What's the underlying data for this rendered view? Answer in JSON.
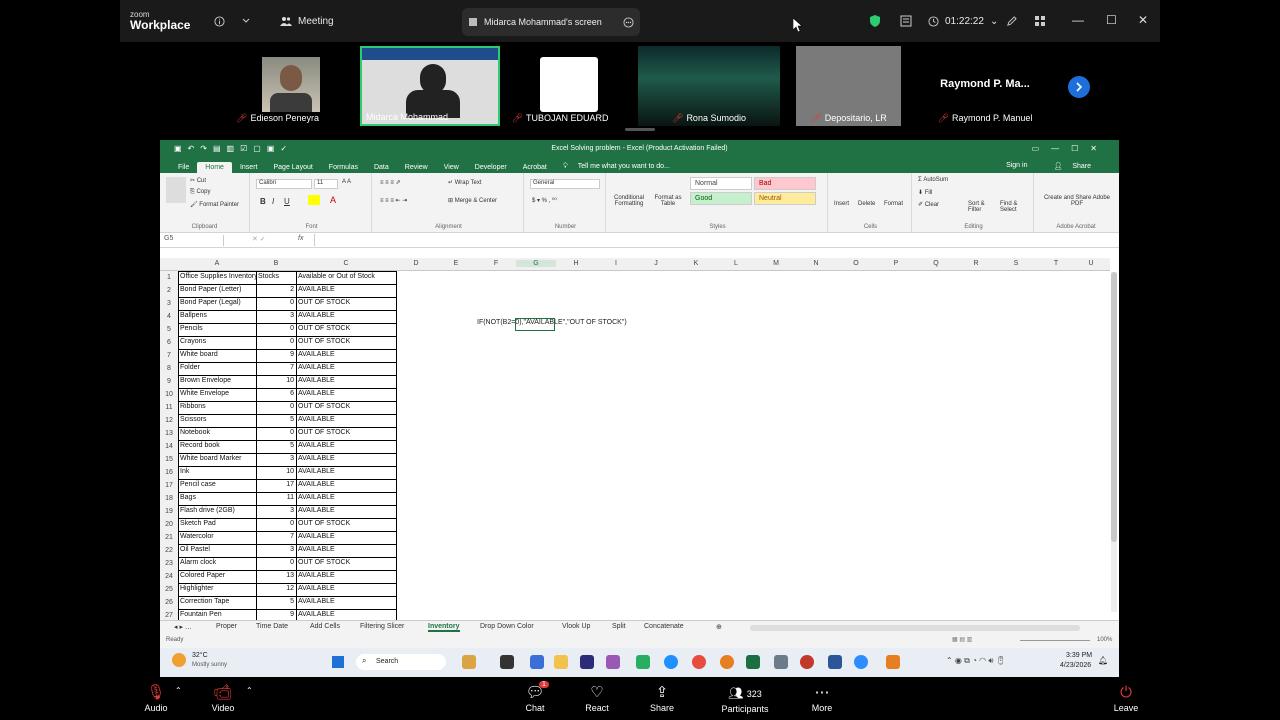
{
  "zoom": {
    "brand_line1": "zoom",
    "brand_line2": "Workplace",
    "meeting_label": "Meeting",
    "screen_label": "Midarca Mohammad's screen",
    "timer": "01:22:22",
    "participants": [
      {
        "name": "Edieson Peneyra"
      },
      {
        "name": "Midarca Mohammad"
      },
      {
        "name": "TUBOJAN EDUARD"
      },
      {
        "name": "Rona Sumodio"
      },
      {
        "name": "Depositario, LR"
      },
      {
        "name": "Raymond P. Manuel",
        "display": "Raymond P. Ma..."
      }
    ],
    "bottom": {
      "audio": "Audio",
      "video": "Video",
      "chat": "Chat",
      "chat_badge": "1",
      "react": "React",
      "share": "Share",
      "participants": "Participants",
      "participants_count": "323",
      "more": "More",
      "leave": "Leave"
    }
  },
  "excel": {
    "title": "Excel Solving problem - Excel (Product Activation Failed)",
    "tabs": [
      "File",
      "Home",
      "Insert",
      "Page Layout",
      "Formulas",
      "Data",
      "Review",
      "View",
      "Developer",
      "Acrobat"
    ],
    "tell_me": "Tell me what you want to do...",
    "sign_in": "Sign in",
    "share": "Share",
    "ribbon": {
      "cut": "Cut",
      "copy": "Copy",
      "format_painter": "Format Painter",
      "clipboard": "Clipboard",
      "font_name": "Calibri",
      "font_size": "11",
      "font": "Font",
      "wrap_text": "Wrap Text",
      "merge_center": "Merge & Center",
      "alignment": "Alignment",
      "number_format": "General",
      "number": "Number",
      "conditional_formatting": "Conditional Formatting",
      "format_as_table": "Format as Table",
      "style_normal": "Normal",
      "style_bad": "Bad",
      "style_good": "Good",
      "style_neutral": "Neutral",
      "styles": "Styles",
      "insert": "Insert",
      "delete": "Delete",
      "format": "Format",
      "cells": "Cells",
      "autosum": "AutoSum",
      "fill": "Fill",
      "clear": "Clear",
      "sort_filter": "Sort & Filter",
      "find_select": "Find & Select",
      "editing": "Editing",
      "create_share_pdf": "Create and Share Adobe PDF",
      "adobe_acrobat": "Adobe Acrobat"
    },
    "name_box": "G5",
    "columns": [
      "A",
      "B",
      "C",
      "D",
      "E",
      "F",
      "G",
      "H",
      "I",
      "J",
      "K",
      "L",
      "M",
      "N",
      "O",
      "P",
      "Q",
      "R",
      "S",
      "T",
      "U"
    ],
    "headers": {
      "a": "Office Supplies Inventory",
      "b": "Stocks",
      "c": "Available or Out of Stock"
    },
    "rows": [
      {
        "item": "Bond Paper (Letter)",
        "stock": "2",
        "status": "AVAILABLE"
      },
      {
        "item": "Bond Paper (Legal)",
        "stock": "0",
        "status": "OUT OF STOCK"
      },
      {
        "item": "Ballpens",
        "stock": "3",
        "status": "AVAILABLE"
      },
      {
        "item": "Pencils",
        "stock": "0",
        "status": "OUT OF STOCK"
      },
      {
        "item": "Crayons",
        "stock": "0",
        "status": "OUT OF STOCK"
      },
      {
        "item": "White board",
        "stock": "9",
        "status": "AVAILABLE"
      },
      {
        "item": "Folder",
        "stock": "7",
        "status": "AVAILABLE"
      },
      {
        "item": "Brown Envelope",
        "stock": "10",
        "status": "AVAILABLE"
      },
      {
        "item": "White Envelope",
        "stock": "6",
        "status": "AVAILABLE"
      },
      {
        "item": "Ribbons",
        "stock": "0",
        "status": "OUT OF STOCK"
      },
      {
        "item": "Scissors",
        "stock": "5",
        "status": "AVAILABLE"
      },
      {
        "item": "Notebook",
        "stock": "0",
        "status": "OUT OF STOCK"
      },
      {
        "item": "Record book",
        "stock": "5",
        "status": "AVAILABLE"
      },
      {
        "item": "White board Marker",
        "stock": "3",
        "status": "AVAILABLE"
      },
      {
        "item": "Ink",
        "stock": "10",
        "status": "AVAILABLE"
      },
      {
        "item": "Pencil case",
        "stock": "17",
        "status": "AVAILABLE"
      },
      {
        "item": "Bags",
        "stock": "11",
        "status": "AVAILABLE"
      },
      {
        "item": "Flash drive (2GB)",
        "stock": "3",
        "status": "AVAILABLE"
      },
      {
        "item": "Sketch Pad",
        "stock": "0",
        "status": "OUT OF STOCK"
      },
      {
        "item": "Watercolor",
        "stock": "7",
        "status": "AVAILABLE"
      },
      {
        "item": "Oil Pastel",
        "stock": "3",
        "status": "AVAILABLE"
      },
      {
        "item": "Alarm clock",
        "stock": "0",
        "status": "OUT OF STOCK"
      },
      {
        "item": "Colored Paper",
        "stock": "13",
        "status": "AVAILABLE"
      },
      {
        "item": "Highlighter",
        "stock": "12",
        "status": "AVAILABLE"
      },
      {
        "item": "Correction Tape",
        "stock": "5",
        "status": "AVAILABLE"
      },
      {
        "item": "Fountain Pen",
        "stock": "9",
        "status": "AVAILABLE"
      }
    ],
    "formula_overlay": "IF(NOT(B2=0),\"AVAILABLE\",\"OUT OF STOCK\")",
    "sheet_tabs": [
      "Proper",
      "Time Date",
      "Add Cells",
      "Filtering Slicer",
      "Inventory",
      "Drop Down Color",
      "Vlook Up",
      "Split",
      "Concatenate"
    ],
    "active_sheet": "Inventory",
    "status_ready": "Ready",
    "zoom_level": "100%"
  },
  "taskbar": {
    "weather_temp": "32°C",
    "weather_desc": "Mostly sunny",
    "search": "Search",
    "time": "3:39 PM",
    "date": "4/23/2026"
  },
  "colors": {
    "excel_green": "#207245",
    "zoom_bg": "#1a1a1a",
    "mic_muted": "#e03a3a",
    "active_speaker": "#2ecc71"
  }
}
